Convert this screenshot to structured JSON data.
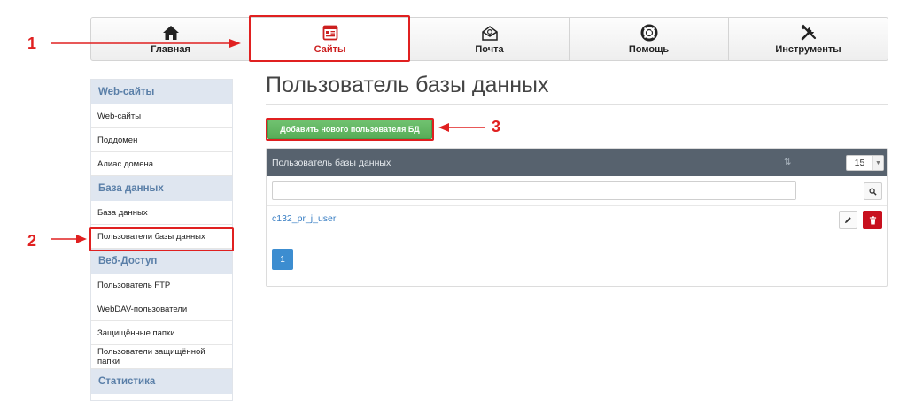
{
  "nav": {
    "tabs": [
      {
        "label": "Главная",
        "icon": "home-icon"
      },
      {
        "label": "Сайты",
        "icon": "sites-icon",
        "active": true
      },
      {
        "label": "Почта",
        "icon": "mail-icon"
      },
      {
        "label": "Помощь",
        "icon": "lifebuoy-icon"
      },
      {
        "label": "Инструменты",
        "icon": "tools-icon"
      }
    ]
  },
  "annotations": [
    "1",
    "2",
    "3"
  ],
  "sidebar": {
    "sections": [
      {
        "title": "Web-сайты",
        "items": [
          "Web-сайты",
          "Поддомен",
          "Алиас домена"
        ]
      },
      {
        "title": "База данных",
        "items": [
          "База данных",
          "Пользователи базы данных"
        ]
      },
      {
        "title": "Веб-Доступ",
        "items": [
          "Пользователь FTP",
          "WebDAV-пользователи",
          "Защищённые папки",
          "Пользователи защищённой папки"
        ]
      },
      {
        "title": "Статистика",
        "items": []
      }
    ]
  },
  "main": {
    "title": "Пользователь базы данных",
    "add_button": "Добавить нового пользователя БД",
    "table": {
      "column": "Пользователь базы данных",
      "per_page": "15",
      "rows": [
        "c132_pr_j_user"
      ],
      "page": "1"
    }
  },
  "colors": {
    "accent_red": "#cc1f1f",
    "annotation": "#e02020",
    "add_green": "#5cb85c",
    "header_dark": "#57626e",
    "link_blue": "#3a7fc4",
    "pager_blue": "#3c8dd0",
    "delete_red": "#c8101e"
  }
}
